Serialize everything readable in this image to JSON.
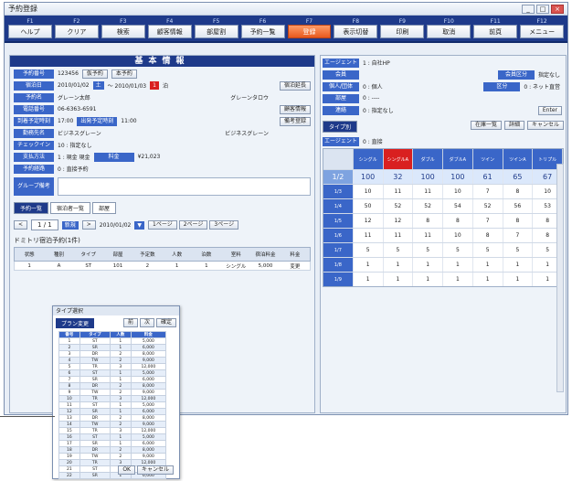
{
  "window": {
    "title": "予約登録"
  },
  "fkeys": [
    {
      "n": "F1",
      "label": "ヘルプ"
    },
    {
      "n": "F2",
      "label": "クリア"
    },
    {
      "n": "F3",
      "label": "検索"
    },
    {
      "n": "F4",
      "label": "顧客情報"
    },
    {
      "n": "F5",
      "label": "部屋割"
    },
    {
      "n": "F6",
      "label": "予約一覧"
    },
    {
      "n": "F7",
      "label": "登録"
    },
    {
      "n": "F8",
      "label": "表示切替"
    },
    {
      "n": "F9",
      "label": "印刷"
    },
    {
      "n": "F10",
      "label": "取消"
    },
    {
      "n": "F11",
      "label": "前頁"
    },
    {
      "n": "F12",
      "label": "メニュー"
    }
  ],
  "basic": {
    "heading": "基本情報",
    "rows": [
      {
        "label": "予約番号",
        "value": "123456",
        "b1": "仮予約",
        "b2": "本予約"
      },
      {
        "label": "宿泊日",
        "value": "2010/01/02",
        "tag": "土",
        "to": "〜 2010/01/03",
        "nights": "1",
        "nightsLabel": "泊",
        "btn": "宿泊延長"
      },
      {
        "label": "予約名",
        "value": "グレーン太郎",
        "kana": "グレーンタロウ"
      },
      {
        "label": "電話番号",
        "value": "06-6363-6591",
        "btn": "顧客情報"
      },
      {
        "label": "到着予定時刻",
        "value": "17:00",
        "label2": "出発予定時刻",
        "value2": "11:00",
        "btn": "備考登録"
      },
      {
        "label": "勤務先名",
        "value": "ビジネスグレーン",
        "kana": "ビジネスグレーン"
      },
      {
        "label": "チェックイン",
        "value": "10 : 指定なし"
      },
      {
        "label": "支払方法",
        "value": "1 : 現金 現金",
        "label2": "料金",
        "value2": "¥21,023"
      },
      {
        "label": "予約経路",
        "value": "0 : 直接予約"
      }
    ],
    "memoLabel": "グループ備考",
    "tabs": [
      "予約一覧",
      "宿泊者一覧",
      "部屋"
    ],
    "navPage": "1 / 1",
    "navBtn": "新規",
    "navDate": "2010/01/02",
    "navBtns": [
      "1ページ",
      "2ページ",
      "3ページ"
    ],
    "listTitle": "ドミトリ宿泊予約(1件)",
    "cols": [
      "状態",
      "種別",
      "タイプ",
      "部屋",
      "予定数",
      "人数",
      "泊数",
      "室料",
      "宿泊料金",
      "料金"
    ],
    "rows2": [
      [
        "1",
        "A",
        "ST",
        "101",
        "2",
        "1",
        "1",
        "シングル",
        "5,000",
        "変更"
      ]
    ]
  },
  "popup": {
    "title": "タイプ選択",
    "tab": "プラン変更",
    "btns": [
      "前",
      "次",
      "確定"
    ],
    "head": [
      "番号",
      "タイプ",
      "人数",
      "料金"
    ],
    "items": [
      [
        "1",
        "ST",
        "1",
        "5,000"
      ],
      [
        "2",
        "SR",
        "1",
        "6,000"
      ],
      [
        "3",
        "DR",
        "2",
        "8,000"
      ],
      [
        "4",
        "TW",
        "2",
        "9,000"
      ],
      [
        "5",
        "TR",
        "3",
        "12,000"
      ],
      [
        "6",
        "ST",
        "1",
        "5,000"
      ],
      [
        "7",
        "SR",
        "1",
        "6,000"
      ],
      [
        "8",
        "DR",
        "2",
        "8,000"
      ],
      [
        "9",
        "TW",
        "2",
        "9,000"
      ],
      [
        "10",
        "TR",
        "3",
        "12,000"
      ],
      [
        "11",
        "ST",
        "1",
        "5,000"
      ],
      [
        "12",
        "SR",
        "1",
        "6,000"
      ],
      [
        "13",
        "DR",
        "2",
        "8,000"
      ],
      [
        "14",
        "TW",
        "2",
        "9,000"
      ],
      [
        "15",
        "TR",
        "3",
        "12,000"
      ],
      [
        "16",
        "ST",
        "1",
        "5,000"
      ],
      [
        "17",
        "SR",
        "1",
        "6,000"
      ],
      [
        "18",
        "DR",
        "2",
        "8,000"
      ],
      [
        "19",
        "TW",
        "2",
        "9,000"
      ],
      [
        "20",
        "TR",
        "3",
        "12,000"
      ],
      [
        "21",
        "ST",
        "1",
        "5,000"
      ],
      [
        "22",
        "SR",
        "1",
        "6,000"
      ]
    ],
    "ok": "OK",
    "cancel": "キャンセル"
  },
  "right": {
    "rows": [
      {
        "label": "エージェント",
        "value": "1 : 自社HP"
      },
      {
        "label": "会員",
        "value": "",
        "label2": "会員区分",
        "value2": "指定なし"
      },
      {
        "label": "個人/団体",
        "value": "0 : 個人",
        "label2": "区分",
        "value2": "0 : ネット直営"
      },
      {
        "label": "部屋",
        "value": "0 : ----"
      },
      {
        "label": "連絡",
        "value": "0 : 指定なし",
        "btn": "Enter"
      }
    ],
    "tab": "タイプ別",
    "btns": [
      "在庫一覧",
      "詳細",
      "キャンセル"
    ],
    "roomLabel": "エージェント",
    "roomVal": "0 : 直接",
    "gridHead": [
      "",
      "シングル",
      "シングルA",
      "ダブル",
      "ダブルA",
      "ツイン",
      "ツインA",
      "トリプル"
    ],
    "gridRows": [
      [
        "1/2",
        "100",
        "32",
        "100",
        "100",
        "61",
        "65",
        "67"
      ],
      [
        "1/3",
        "10",
        "11",
        "11",
        "10",
        "7",
        "8",
        "10"
      ],
      [
        "1/4",
        "50",
        "52",
        "52",
        "54",
        "52",
        "56",
        "53"
      ],
      [
        "1/5",
        "12",
        "12",
        "8",
        "8",
        "7",
        "8",
        "8"
      ],
      [
        "1/6",
        "11",
        "11",
        "11",
        "10",
        "8",
        "7",
        "8"
      ],
      [
        "1/7",
        "5",
        "5",
        "5",
        "5",
        "5",
        "5",
        "5"
      ],
      [
        "1/8",
        "1",
        "1",
        "1",
        "1",
        "1",
        "1",
        "1"
      ],
      [
        "1/9",
        "1",
        "1",
        "1",
        "1",
        "1",
        "1",
        "1"
      ]
    ]
  }
}
